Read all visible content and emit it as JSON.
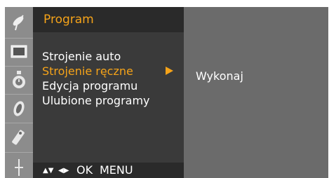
{
  "menu": {
    "title": "Program",
    "items": [
      {
        "label": "Strojenie auto",
        "selected": false
      },
      {
        "label": "Strojenie ręczne",
        "selected": true
      },
      {
        "label": "Edycja programu",
        "selected": false
      },
      {
        "label": "Ulubione programy",
        "selected": false
      }
    ]
  },
  "submenu": {
    "label": "Wykonaj"
  },
  "footer": {
    "ok_label": "OK",
    "menu_label": "MENU"
  },
  "sidebar": {
    "icons": [
      "satellite-dish-icon",
      "screen-icon",
      "clock-icon",
      "option-icon",
      "lock-icon",
      "input-icon"
    ]
  },
  "colors": {
    "accent": "#f5a319",
    "sidebar_bg": "#8c8c8c",
    "panel_bg": "#3a3a3a",
    "bar_bg": "#2a2a2a",
    "sub_bg": "#6b6b6b"
  }
}
